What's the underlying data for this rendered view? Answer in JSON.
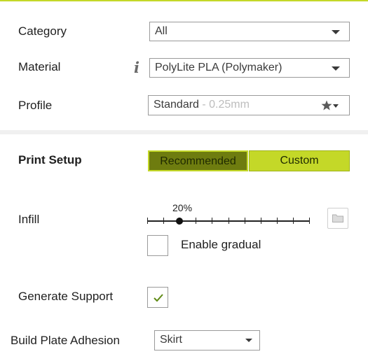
{
  "colors": {
    "accent": "#c4d828",
    "accent_dark": "#6e7c0f",
    "top_rule": "#c4d828"
  },
  "material_section": {
    "category": {
      "label": "Category",
      "value": "All"
    },
    "material": {
      "label": "Material",
      "info_icon": "i",
      "value": "PolyLite PLA (Polymaker)"
    },
    "profile": {
      "label": "Profile",
      "value": "Standard",
      "hint": " - 0.25mm"
    }
  },
  "print_setup": {
    "title": "Print Setup",
    "modes": {
      "recommended": "Recommended",
      "custom": "Custom",
      "selected": "Recommended"
    }
  },
  "infill": {
    "label": "Infill",
    "value_label": "20%",
    "value_fraction": 0.2,
    "gradual_label": "Enable gradual",
    "gradual_checked": false
  },
  "support": {
    "label": "Generate Support",
    "checked": true
  },
  "adhesion": {
    "label": "Build Plate Adhesion",
    "value": "Skirt"
  },
  "icons": [
    "info-icon",
    "star-icon",
    "chevron-down-icon",
    "checkmark-icon",
    "folder-icon"
  ]
}
